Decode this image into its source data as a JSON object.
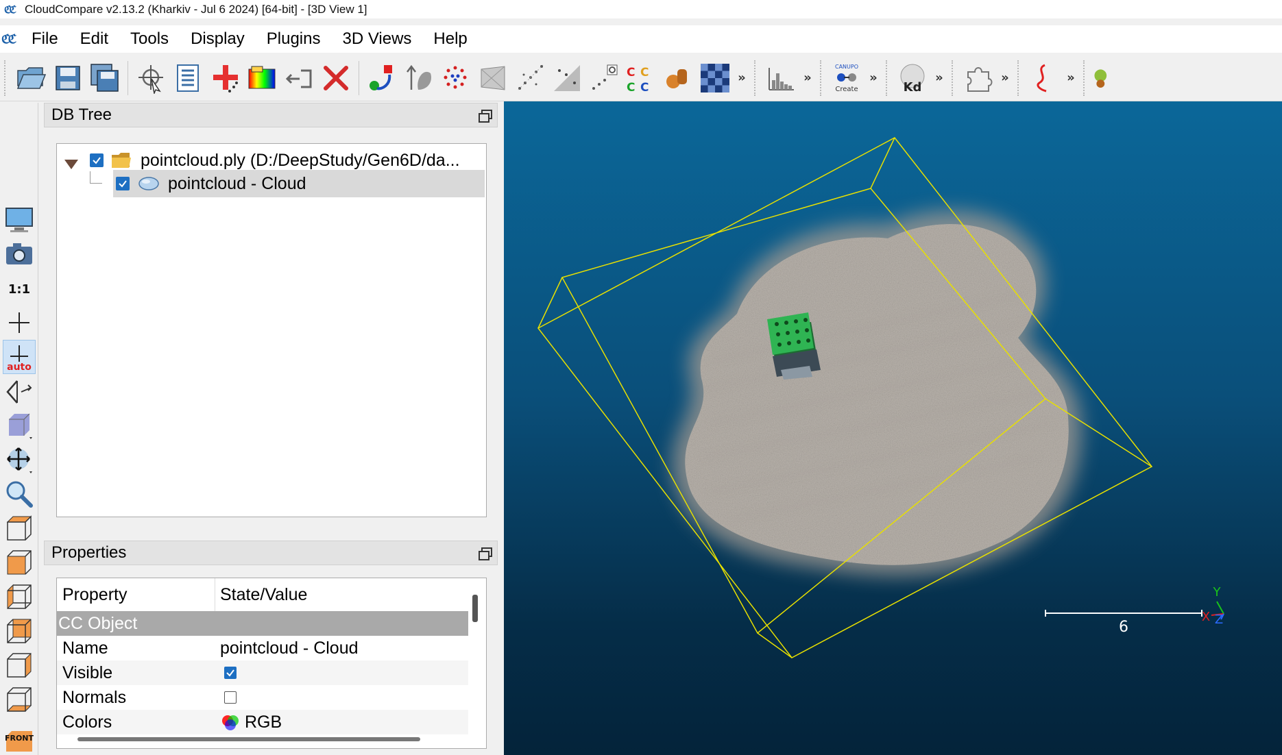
{
  "window": {
    "title": "CloudCompare v2.13.2 (Kharkiv - Jul  6 2024) [64-bit] - [3D View 1]"
  },
  "menu": {
    "items": [
      {
        "label": "File"
      },
      {
        "label": "Edit"
      },
      {
        "label": "Tools"
      },
      {
        "label": "Display"
      },
      {
        "label": "Plugins"
      },
      {
        "label": "3D Views"
      },
      {
        "label": "Help"
      }
    ]
  },
  "toolbar": {
    "canupo_top": "CANUPO",
    "canupo_bottom": "Create",
    "kd_label": "Kd",
    "cc_label": "CC"
  },
  "left_toolbar": {
    "zoom_label": "1:1",
    "auto_label": "auto",
    "front_label": "FRONT"
  },
  "db_tree": {
    "title": "DB Tree",
    "items": [
      {
        "label": "pointcloud.ply (D:/DeepStudy/Gen6D/da...",
        "checked": true,
        "icon": "folder-icon"
      },
      {
        "label": "pointcloud - Cloud",
        "checked": true,
        "icon": "cloud-icon",
        "selected": true
      }
    ]
  },
  "properties": {
    "title": "Properties",
    "headers": {
      "property": "Property",
      "value": "State/Value"
    },
    "group": "CC Object",
    "rows": [
      {
        "name": "Name",
        "value": "pointcloud - Cloud"
      },
      {
        "name": "Visible",
        "value": "checked"
      },
      {
        "name": "Normals",
        "value": "unchecked"
      },
      {
        "name": "Colors",
        "value": "RGB"
      }
    ]
  },
  "view3d": {
    "scale_label": "6",
    "axes": {
      "x": "X",
      "y": "Y",
      "z": "Z"
    },
    "colors": {
      "bbox": "#e8e000",
      "cloud": "#b8b2aa",
      "object": "#1fa84a"
    }
  }
}
